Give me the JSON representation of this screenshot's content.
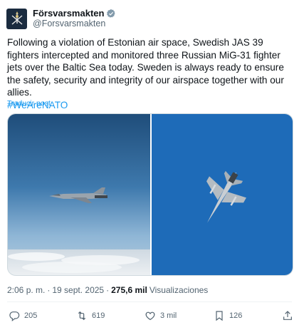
{
  "author": {
    "display_name": "Försvarsmakten",
    "handle": "@Forsvarsmakten"
  },
  "tweet": {
    "text": "Following a violation of Estonian air space, Swedish JAS 39 fighters intercepted and monitored three Russian MiG-31 fighter jets over the Baltic Sea today. Sweden is always ready to ensure the safety, security and integrity of our airspace together with our allies.",
    "hashtag": "#WeAreNATO",
    "translate_label": "Traducir post"
  },
  "meta": {
    "time": "2:06 p. m.",
    "separator": "·",
    "date": "19 sept. 2025",
    "separator2": "·",
    "views_count": "275,6 mil",
    "views_label": "Visualizaciones"
  },
  "actions": {
    "replies": "205",
    "reposts": "619",
    "likes": "3 mil",
    "bookmarks": "126"
  },
  "icons": {
    "avatar": "swedish-armed-forces-emblem-icon",
    "verified": "verified-badge-icon",
    "reply": "reply-icon",
    "repost": "repost-icon",
    "like": "heart-icon",
    "bookmark": "bookmark-icon",
    "share": "share-icon"
  },
  "colors": {
    "link": "#1d9bf0",
    "secondary_text": "#536471",
    "verified_badge": "#829aab"
  }
}
